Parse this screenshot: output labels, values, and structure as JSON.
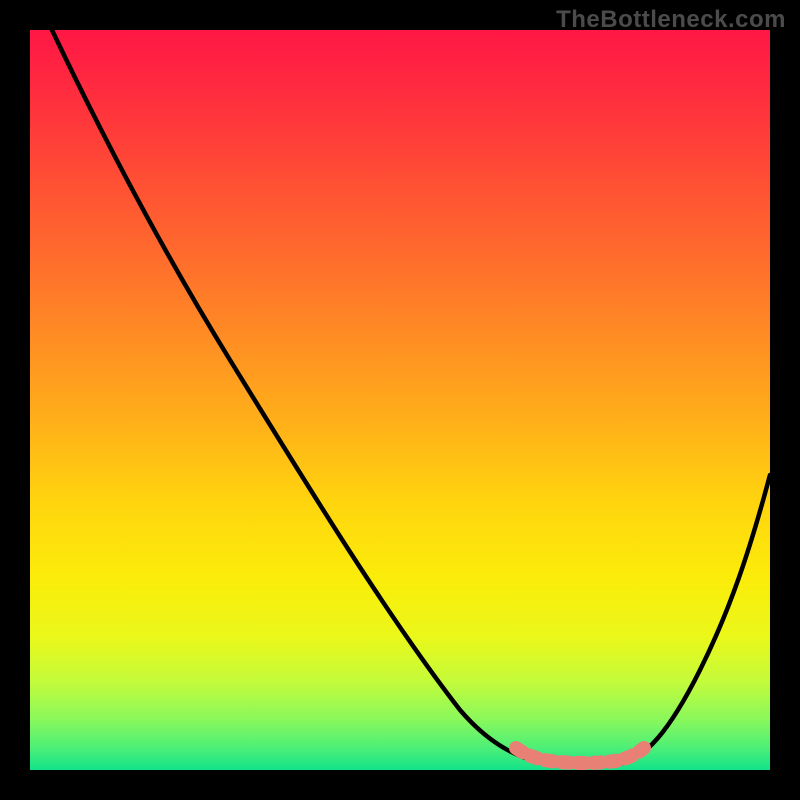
{
  "watermark": "TheBottleneck.com",
  "chart_data": {
    "type": "line",
    "title": "",
    "xlabel": "",
    "ylabel": "",
    "xlim": [
      0,
      100
    ],
    "ylim": [
      0,
      100
    ],
    "grid": false,
    "legend": false,
    "series": [
      {
        "name": "bottleneck-curve",
        "x": [
          3,
          10,
          20,
          30,
          40,
          50,
          55,
          60,
          65,
          70,
          75,
          80,
          85,
          90,
          95,
          100
        ],
        "y": [
          100,
          88,
          72,
          57,
          41,
          25,
          17,
          10,
          4,
          1,
          0,
          0,
          4,
          14,
          28,
          44
        ]
      },
      {
        "name": "optimal-band",
        "x": [
          68,
          71,
          74,
          77,
          80
        ],
        "y": [
          2,
          1,
          0.8,
          1,
          2
        ]
      }
    ],
    "gradient_stops": [
      {
        "pos": 0,
        "color": "#ff1745"
      },
      {
        "pos": 50,
        "color": "#ffb318"
      },
      {
        "pos": 80,
        "color": "#eaf81a"
      },
      {
        "pos": 100,
        "color": "#13e38b"
      }
    ]
  }
}
